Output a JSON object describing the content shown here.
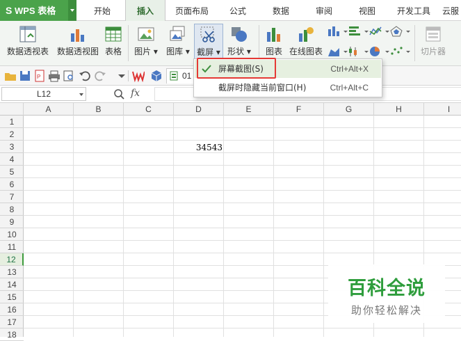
{
  "app": {
    "name": "WPS 表格"
  },
  "menu_tabs": [
    "开始",
    "插入",
    "页面布局",
    "公式",
    "数据",
    "审阅",
    "视图",
    "开发工具",
    "云服"
  ],
  "active_tab": "插入",
  "ribbon": {
    "pivot_table": "数据透视表",
    "pivot_chart": "数据透视图",
    "table": "表格",
    "picture": "图片",
    "gallery": "图库",
    "screenshot": "截屏",
    "shapes": "形状",
    "chart": "图表",
    "online_chart": "在线图表",
    "slicer": "切片器"
  },
  "quick_access": {
    "doc_tab_label": "01"
  },
  "formula_bar": {
    "name_box": "L12",
    "fx_label": "fx",
    "value": ""
  },
  "sheet": {
    "columns": [
      "A",
      "B",
      "C",
      "D",
      "E",
      "F",
      "G",
      "H",
      "I"
    ],
    "rows": [
      "1",
      "2",
      "3",
      "4",
      "5",
      "6",
      "7",
      "8",
      "9",
      "10",
      "11",
      "12",
      "13",
      "14",
      "15",
      "16",
      "17",
      "18"
    ],
    "selected_row": "12",
    "cell_d3": "34543"
  },
  "dropdown": {
    "items": [
      {
        "label": "屏幕截图(S)",
        "shortcut": "Ctrl+Alt+X",
        "checked": true
      },
      {
        "label": "截屏时隐藏当前窗口(H)",
        "shortcut": "Ctrl+Alt+C",
        "checked": false
      }
    ]
  },
  "watermark": {
    "title": "百科全说",
    "subtitle": "助你轻松解决"
  },
  "colors": {
    "brand_green": "#4ba34b",
    "highlight_red": "#e53935",
    "watermark_green": "#2e9d3c"
  }
}
